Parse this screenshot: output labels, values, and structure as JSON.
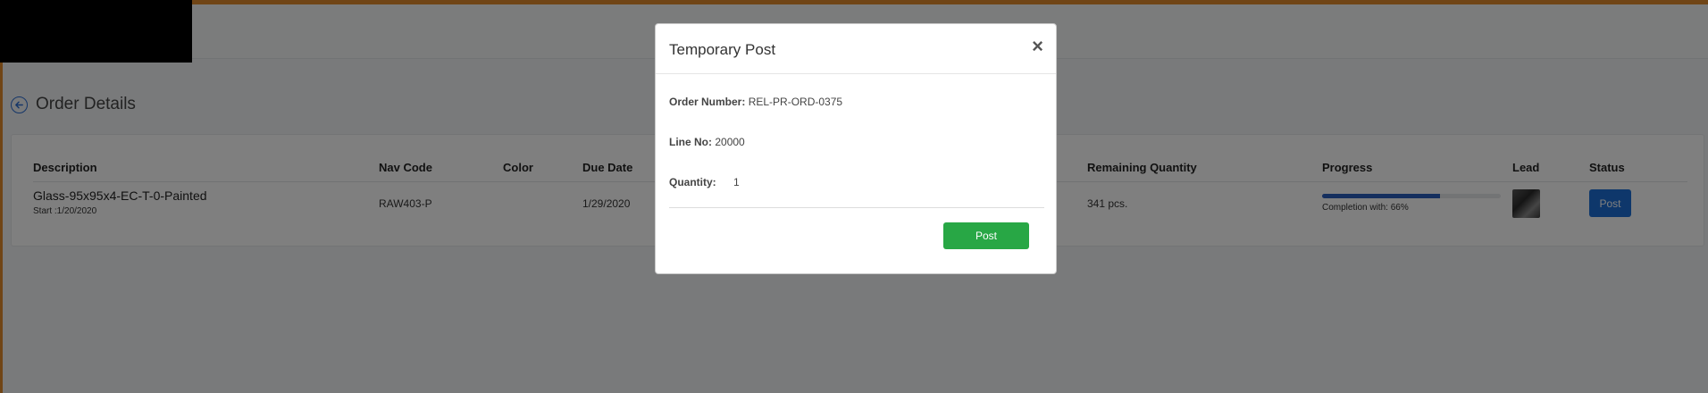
{
  "page": {
    "title": "Order Details"
  },
  "table": {
    "headers": {
      "description": "Description",
      "nav_code": "Nav Code",
      "color": "Color",
      "due_date": "Due Date",
      "remaining_quantity": "Remaining Quantity",
      "progress": "Progress",
      "lead": "Lead",
      "status": "Status"
    },
    "rows": [
      {
        "description": "Glass-95x95x4-EC-T-0-Painted",
        "start": "Start :1/20/2020",
        "nav_code": "RAW403-P",
        "color": "",
        "due_date": "1/29/2020",
        "remaining_quantity": "341 pcs.",
        "progress_percent": 66,
        "progress_text": "Completion with: 66%",
        "status_button": "Post"
      }
    ]
  },
  "modal": {
    "title": "Temporary Post",
    "close_symbol": "×",
    "order_number_label": "Order Number:",
    "order_number_value": "REL-PR-ORD-0375",
    "line_no_label": "Line No:",
    "line_no_value": "20000",
    "quantity_label": "Quantity:",
    "quantity_value": "1",
    "post_button": "Post"
  },
  "colors": {
    "accent_orange": "#e08a2c",
    "primary_blue": "#1d6fd6",
    "success_green": "#28a745",
    "progress_blue": "#2b5fbd"
  },
  "icons": {
    "back": "arrow-left-circle-icon",
    "close": "close-icon"
  }
}
